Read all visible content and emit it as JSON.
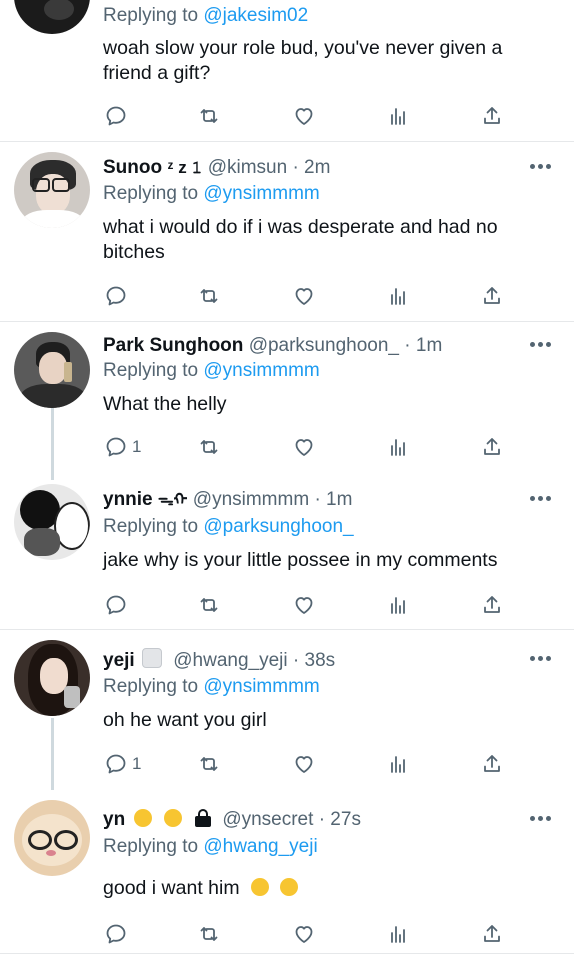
{
  "tweets": [
    {
      "name": "",
      "emoji": "",
      "handle": "",
      "time": "",
      "replying_label": "Replying to",
      "replying_handle": "@jakesim02",
      "body": "woah slow your role bud, you've never given a friend a gift?",
      "reply_count": "",
      "avatar_color": "#1a1a1a"
    },
    {
      "name": "Sunoo",
      "emoji": "ᶻ z 𝟷",
      "handle": "@kimsun",
      "time": "· 2m",
      "replying_label": "Replying to",
      "replying_handle": "@ynsimmmm",
      "body": "what i would do if i was desperate and had no bitches",
      "reply_count": "",
      "avatar_color": "#c9c6c2"
    },
    {
      "name": "Park Sunghoon",
      "emoji": "",
      "handle": "@parksunghoon_",
      "time": "· 1m",
      "replying_label": "Replying to",
      "replying_handle": "@ynsimmmm",
      "body": "What the helly",
      "reply_count": "1",
      "avatar_color": "#4a4a4a"
    },
    {
      "name": "ynnie",
      "emoji": "ᯓᡣ",
      "handle": "@ynsimmmm",
      "time": "· 1m",
      "replying_label": "Replying to",
      "replying_handle": "@parksunghoon_",
      "body": "jake why is your little possee in my comments",
      "reply_count": "",
      "avatar_color": "#dcdcdc"
    },
    {
      "name": "yeji",
      "emoji": "",
      "handle": "@hwang_yeji",
      "time": "· 38s",
      "replying_label": "Replying to",
      "replying_handle": "@ynsimmmm",
      "body": "oh he want you girl",
      "reply_count": "1",
      "avatar_color": "#6b5547"
    },
    {
      "name": "yn",
      "emoji": "",
      "handle": "@ynsecret",
      "time": "· 27s",
      "replying_label": "Replying to",
      "replying_handle": "@hwang_yeji",
      "body": "good i want him",
      "reply_count": "",
      "avatar_color": "#e7c9a9"
    }
  ],
  "colors": {
    "accent": "#1d9bf0",
    "muted": "#536471",
    "text": "#0f1419",
    "separator": "#e6e8ea"
  },
  "icons": [
    "reply-icon",
    "retweet-icon",
    "like-icon",
    "analytics-icon",
    "share-icon",
    "more-icon",
    "lock-icon"
  ]
}
